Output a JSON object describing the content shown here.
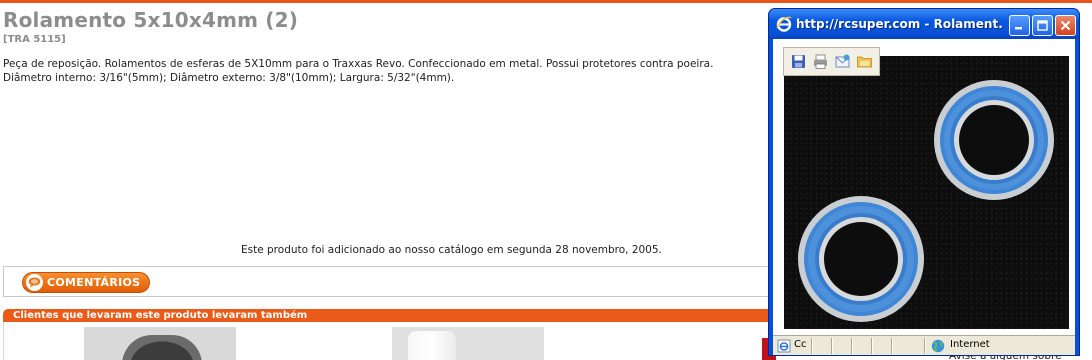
{
  "product": {
    "title": "Rolamento 5x10x4mm (2)",
    "code": "[TRA 5115]",
    "description": "Peça de reposição. Rolamentos de esferas de 5X10mm para o Traxxas Revo. Confeccionado em metal. Possui protetores contra poeira. Diâmetro interno: 3/16\"(5mm); Diâmetro externo: 3/8\"(10mm); Largura: 5/32\"(4mm).",
    "added_note": "Este produto foi adicionado ao nosso catálogo em segunda 28 novembro, 2005."
  },
  "comments": {
    "button_label": "COMENTÁRIOS"
  },
  "also_bought": {
    "title": "Clientes que levaram este produto levaram também"
  },
  "sidebar": {
    "footer_link": "Avise a alguém sobre"
  },
  "popup": {
    "title": "http://rcsuper.com - Rolament...",
    "status_text": "Cc",
    "zone_text": "Internet"
  },
  "colors": {
    "accent": "#ea5a18",
    "title_gray": "#8d8d8d",
    "window_blue": "#0a4fd8",
    "bearing_blue": "#3f86d6"
  },
  "icons": [
    "ie-logo-icon",
    "minimize-icon",
    "maximize-icon",
    "close-icon",
    "save-icon",
    "print-icon",
    "email-icon",
    "folder-icon",
    "globe-icon",
    "comment-icon"
  ]
}
